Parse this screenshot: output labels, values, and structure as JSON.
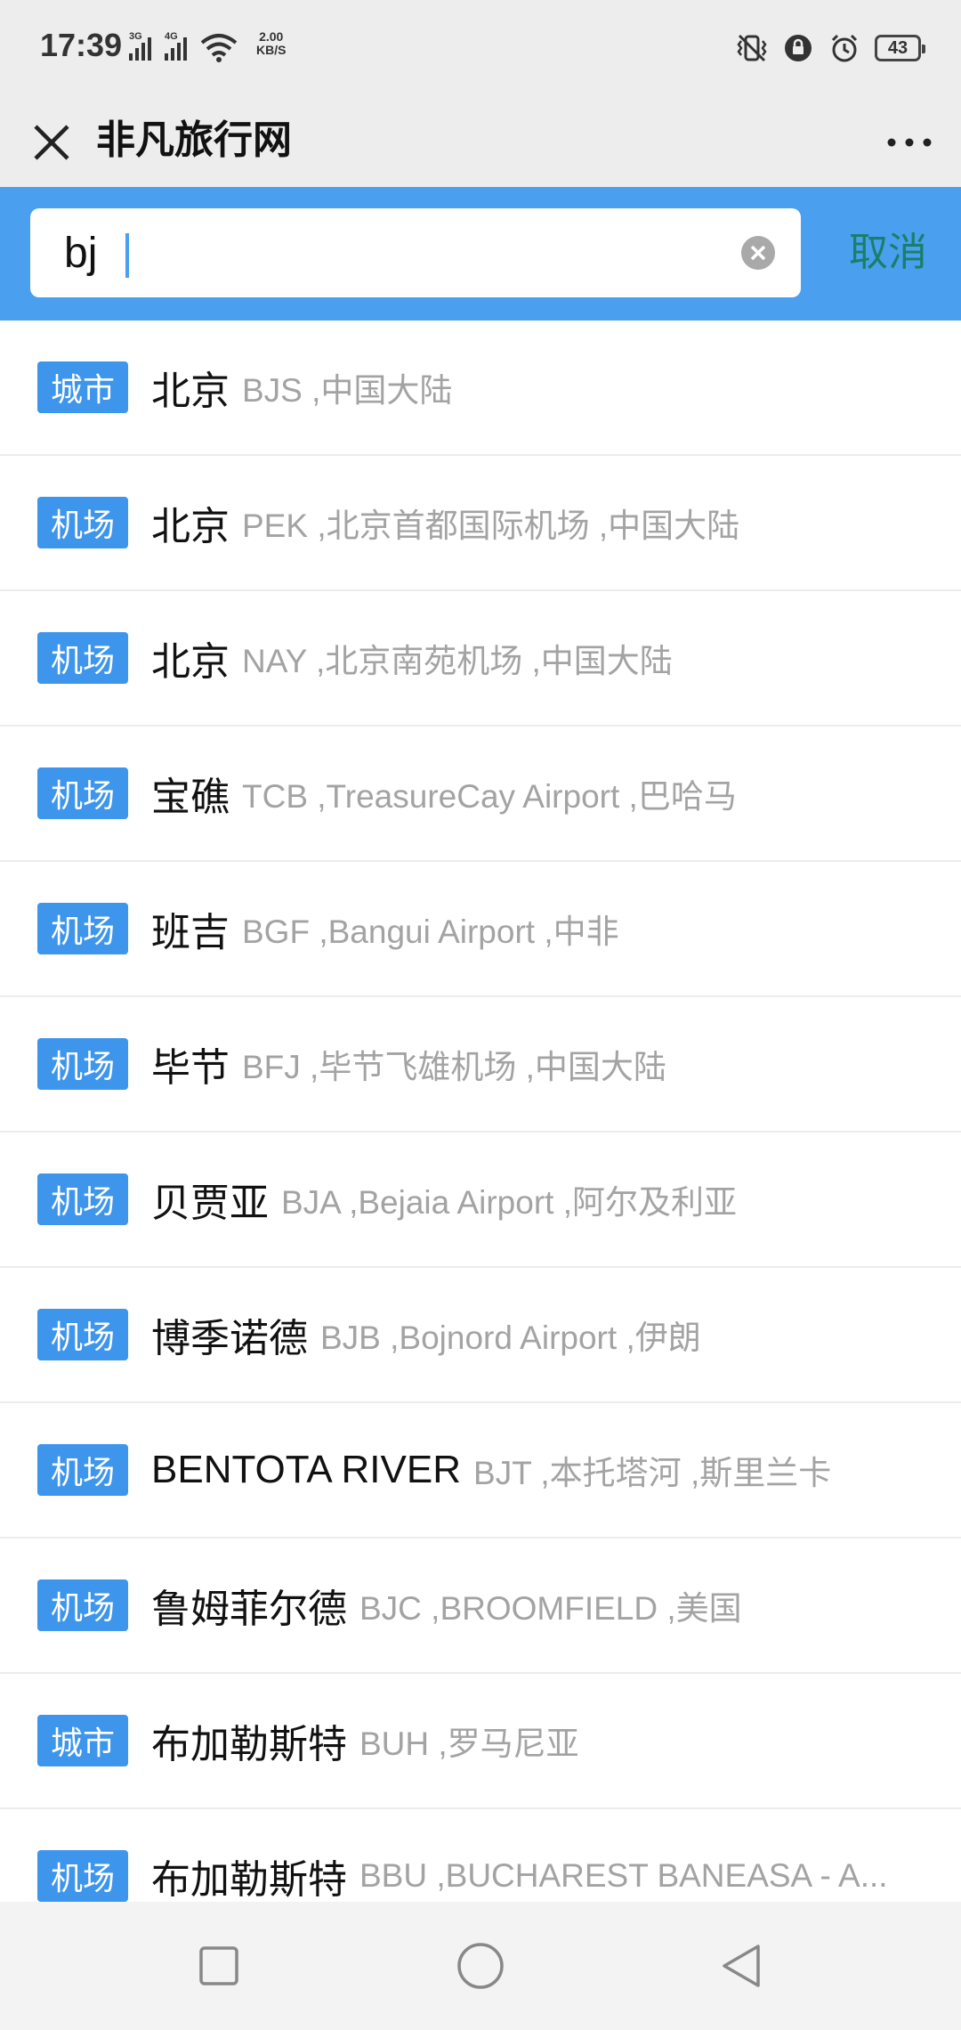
{
  "status_bar": {
    "time": "17:39",
    "net_speed_value": "2.00",
    "net_speed_unit": "KB/S",
    "battery": "43",
    "icons": [
      "signal-3g-icon",
      "signal-4g-icon",
      "wifi-icon",
      "vibrate-icon",
      "lock-rotation-icon",
      "alarm-icon",
      "battery-icon"
    ]
  },
  "title_bar": {
    "title": "非凡旅行网",
    "close_icon": "close-icon",
    "more_icon": "more-icon"
  },
  "search": {
    "value": "bj",
    "cancel_label": "取消",
    "clear_icon": "clear-icon"
  },
  "results": [
    {
      "tag": "城市",
      "name": "北京",
      "detail": "BJS ,中国大陆"
    },
    {
      "tag": "机场",
      "name": "北京",
      "detail": "PEK ,北京首都国际机场 ,中国大陆"
    },
    {
      "tag": "机场",
      "name": "北京",
      "detail": "NAY ,北京南苑机场 ,中国大陆"
    },
    {
      "tag": "机场",
      "name": "宝礁",
      "detail": "TCB ,TreasureCay Airport ,巴哈马"
    },
    {
      "tag": "机场",
      "name": "班吉",
      "detail": "BGF ,Bangui Airport ,中非"
    },
    {
      "tag": "机场",
      "name": "毕节",
      "detail": "BFJ ,毕节飞雄机场 ,中国大陆"
    },
    {
      "tag": "机场",
      "name": "贝贾亚",
      "detail": "BJA ,Bejaia Airport ,阿尔及利亚"
    },
    {
      "tag": "机场",
      "name": "博季诺德",
      "detail": "BJB ,Bojnord Airport ,伊朗"
    },
    {
      "tag": "机场",
      "name": "BENTOTA RIVER",
      "detail": "BJT ,本托塔河 ,斯里兰卡"
    },
    {
      "tag": "机场",
      "name": "鲁姆菲尔德",
      "detail": "BJC ,BROOMFIELD ,美国"
    },
    {
      "tag": "城市",
      "name": "布加勒斯特",
      "detail": "BUH ,罗马尼亚"
    },
    {
      "tag": "机场",
      "name": "布加勒斯特",
      "detail": "BBU ,BUCHAREST BANEASA - A..."
    }
  ],
  "nav_bar": {
    "icons": [
      "recent-apps-icon",
      "home-icon",
      "back-icon"
    ]
  },
  "colors": {
    "accent": "#4a9fef",
    "tag_bg": "#3d95ec",
    "cancel_text": "#1a7f6a",
    "detail_text": "#a3a3a3",
    "bar_bg": "#ededed"
  }
}
